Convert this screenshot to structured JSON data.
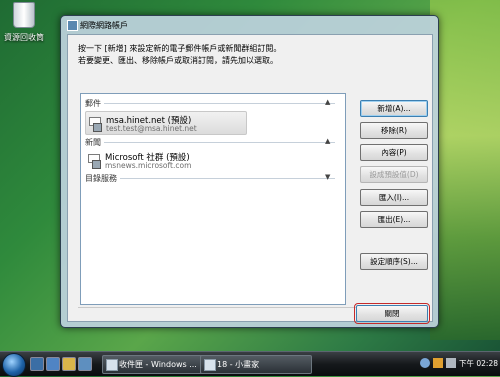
{
  "desktop": {
    "recycle_bin_label": "資源回收筒"
  },
  "window": {
    "title": "網際網路帳戶",
    "instructions": [
      "按一下 [新增] 來設定新的電子郵件帳戶或新聞群組訂閱。",
      "若要變更、匯出、移除帳戶或取消訂閱，請先加以選取。"
    ],
    "groups": {
      "mail": "郵件",
      "news": "新聞",
      "directory": "目錄服務"
    },
    "accounts": [
      {
        "name": "msa.hinet.net (預設)",
        "email": "test.test@msa.hinet.net",
        "selected": true
      },
      {
        "name": "Microsoft 社群 (預設)",
        "email": "msnews.microsoft.com",
        "selected": false
      }
    ],
    "buttons": {
      "add": "新增(A)...",
      "remove": "移除(R)",
      "properties": "內容(P)",
      "set_default": "設成預設值(D)",
      "import": "匯入(I)...",
      "export": "匯出(E)...",
      "set_order": "設定順序(S)..."
    },
    "close": "關閉"
  },
  "taskbar": {
    "tasks": [
      {
        "label": "收件匣 - Windows ..."
      },
      {
        "label": "18 - 小畫家"
      }
    ],
    "clock": "下午 02:28"
  }
}
